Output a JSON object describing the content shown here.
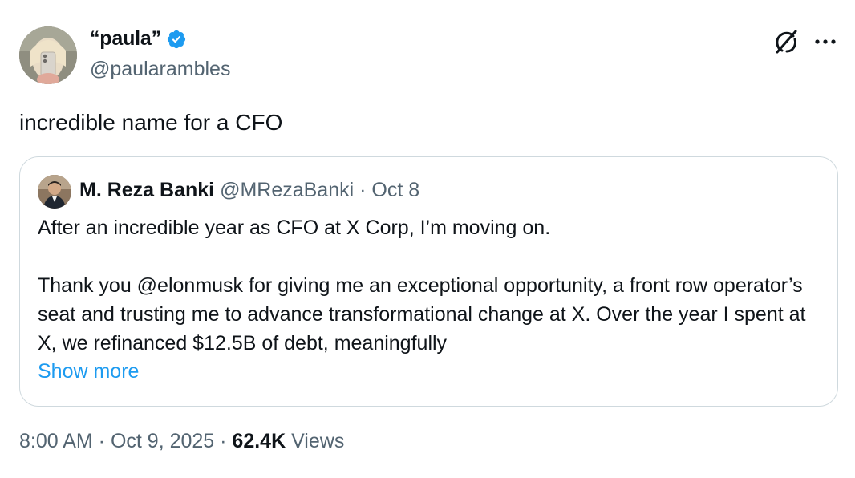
{
  "author": {
    "display_name": "“paula”",
    "handle": "@paularambles",
    "verified_icon": "verified-badge-icon",
    "verified_color": "#1d9bf0"
  },
  "header_actions": {
    "grok_icon": "grok-icon",
    "more_icon": "more-horizontal-icon"
  },
  "tweet": {
    "text": "incredible name for a CFO"
  },
  "quote": {
    "name": "M. Reza Banki",
    "handle": "@MRezaBanki",
    "separator": " · ",
    "date": "Oct 8",
    "paragraph1": "After an incredible year as CFO at X Corp, I’m moving on.",
    "paragraph2": "Thank you @elonmusk for giving me an exceptional opportunity, a front row operator’s seat and trusting me to advance transformational change at X. Over the year I spent at X, we refinanced $12.5B of debt, meaningfully",
    "show_more": "Show more"
  },
  "footer": {
    "time": "8:00 AM",
    "sep1": " · ",
    "date": "Oct 9, 2025",
    "sep2": " · ",
    "views_count": "62.4K",
    "views_label": " Views"
  },
  "colors": {
    "link": "#1d9bf0",
    "secondary_text": "#536471",
    "border": "#cfd9de"
  }
}
